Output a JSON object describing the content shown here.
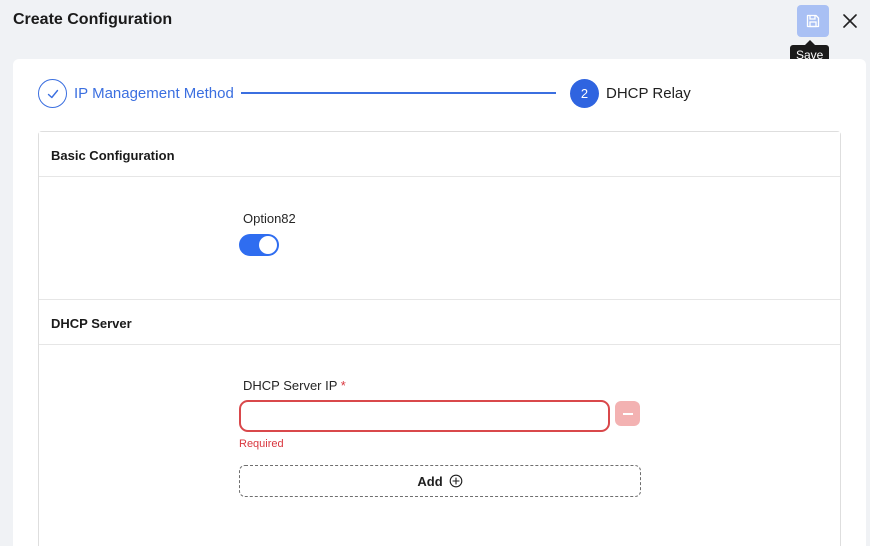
{
  "header": {
    "title": "Create Configuration",
    "save_tooltip": "Save"
  },
  "stepper": {
    "steps": [
      {
        "label": "IP Management Method",
        "status": "completed"
      },
      {
        "number": "2",
        "label": "DHCP Relay",
        "status": "active"
      }
    ]
  },
  "basic_config": {
    "title": "Basic Configuration",
    "option82_label": "Option82",
    "option82_enabled": true
  },
  "dhcp_server": {
    "title": "DHCP Server",
    "ip_label": "DHCP Server IP",
    "required_mark": "*",
    "ip_value": "",
    "error": "Required",
    "add_label": "Add"
  },
  "icons": {
    "save": "save-icon",
    "close": "close-icon",
    "check": "check-icon",
    "remove": "minus-icon",
    "add": "plus-circle-icon"
  },
  "colors": {
    "accent": "#2f64e0",
    "error": "#d9363e",
    "save_button": "#a9c0f4"
  }
}
